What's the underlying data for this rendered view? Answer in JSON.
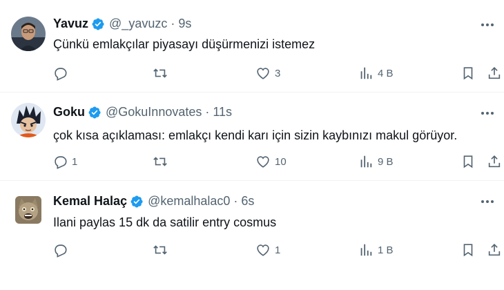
{
  "tweets": [
    {
      "name": "Yavuz",
      "handle": "@_yavuzc",
      "separator": "·",
      "time": "9s",
      "text": "Çünkü emlakçılar piyasayı düşürmenizi istemez",
      "replies": "",
      "retweets": "",
      "likes": "3",
      "views": "4 B",
      "avatar_icon": "person-photo-avatar"
    },
    {
      "name": "Goku",
      "handle": "@GokuInnovates",
      "separator": "·",
      "time": "11s",
      "text": "çok kısa açıklaması: emlakçı kendi karı için sizin kaybınızı makul görüyor.",
      "replies": "1",
      "retweets": "",
      "likes": "10",
      "views": "9 B",
      "avatar_icon": "anime-character-avatar"
    },
    {
      "name": "Kemal Halaç",
      "handle": "@kemalhalac0",
      "separator": "·",
      "time": "6s",
      "text": "Ilani paylas 15 dk da satilir entry cosmus",
      "replies": "",
      "retweets": "",
      "likes": "1",
      "views": "1 B",
      "avatar_icon": "cat-avatar"
    }
  ],
  "colors": {
    "verified": "#1d9bf0",
    "muted": "#536471",
    "text": "#0f1419",
    "divider": "#eff3f4"
  }
}
